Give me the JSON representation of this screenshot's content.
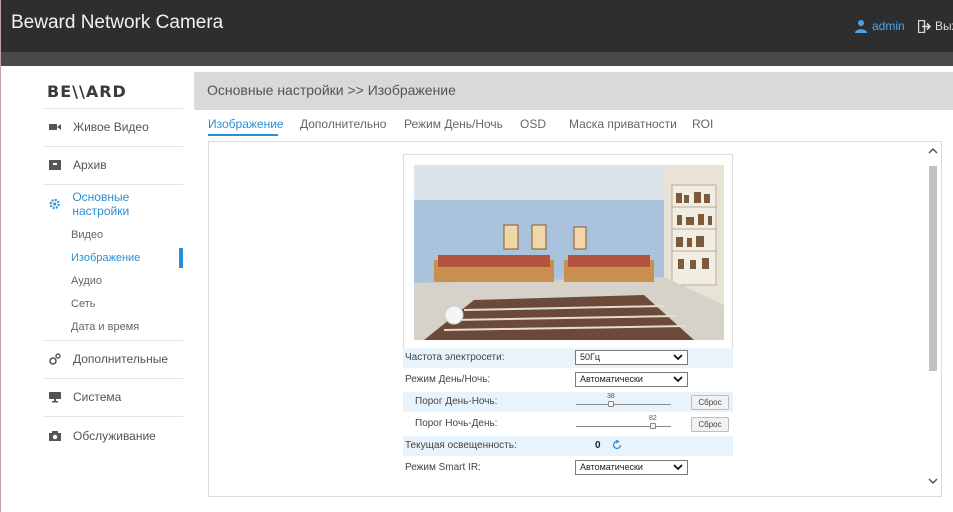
{
  "app": {
    "title": "Beward Network Camera",
    "user": "admin",
    "logout": "Выход"
  },
  "sidebar": {
    "logo": "BEWARD",
    "items": [
      {
        "label": "Живое Видео",
        "icon": "video-camera-icon"
      },
      {
        "label": "Архив",
        "icon": "archive-icon"
      },
      {
        "label": "Основные настройки",
        "icon": "gear-icon"
      },
      {
        "label": "Дополнительные",
        "icon": "settings-gears-icon"
      },
      {
        "label": "Система",
        "icon": "monitor-icon"
      },
      {
        "label": "Обслуживание",
        "icon": "camera-icon"
      }
    ],
    "subitems": [
      "Видео",
      "Изображение",
      "Аудио",
      "Сеть",
      "Дата и время"
    ],
    "active_sub": "Изображение"
  },
  "header": {
    "breadcrumb": "Основные настройки >> Изображение"
  },
  "tabs": [
    "Изображение",
    "Дополнительно",
    "Режим День/Ночь",
    "OSD",
    "Маска приватности",
    "ROI"
  ],
  "settings": {
    "power_freq_label": "Частота электросети:",
    "power_freq_value": "50Гц",
    "day_night_label": "Режим День/Ночь:",
    "day_night_value": "Автоматически",
    "day_to_night_label": "Порог День-Ночь:",
    "day_to_night_value": "38",
    "night_to_day_label": "Порог Ночь-День:",
    "night_to_day_value": "82",
    "reset_label": "Сброс",
    "luminance_label": "Текущая освещенность:",
    "luminance_value": "0",
    "smart_ir_label": "Режим Smart IR:",
    "smart_ir_value": "Автоматически"
  },
  "colors": {
    "accent": "#2b8fd6",
    "topbar": "#2e2e2e",
    "header_bg": "#d9d9d9",
    "row_shade": "#e8f3fb"
  }
}
